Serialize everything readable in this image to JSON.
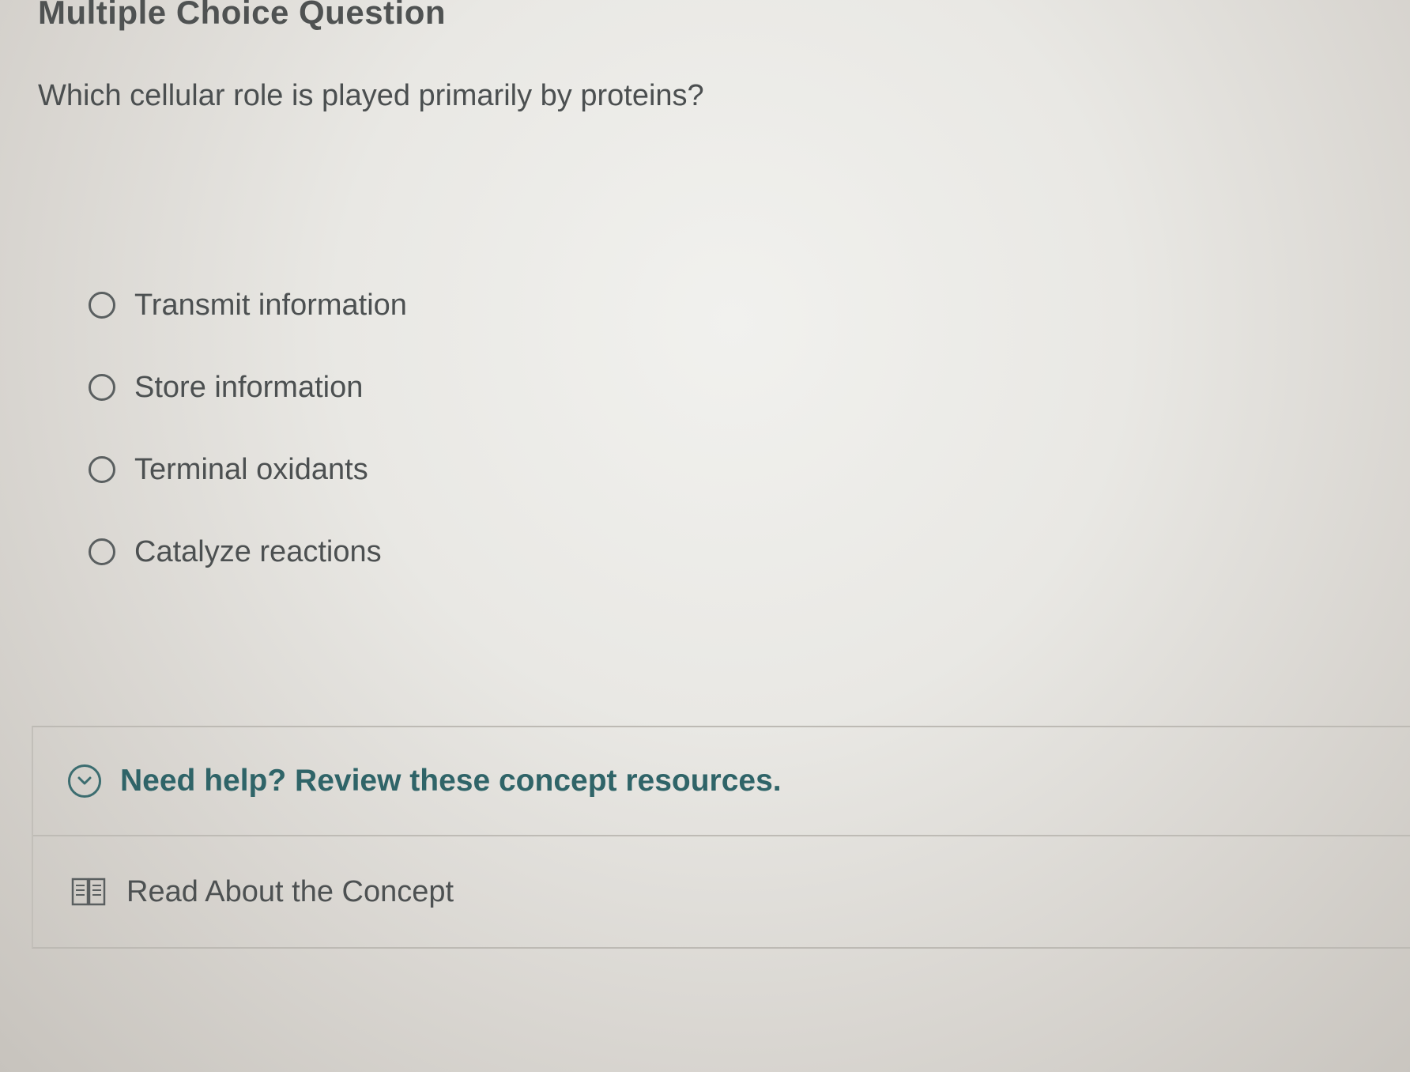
{
  "header": {
    "title": "Multiple Choice Question"
  },
  "question": {
    "text": "Which cellular role is played primarily by proteins?"
  },
  "options": [
    {
      "label": "Transmit information",
      "selected": false
    },
    {
      "label": "Store information",
      "selected": false
    },
    {
      "label": "Terminal oxidants",
      "selected": false
    },
    {
      "label": "Catalyze reactions",
      "selected": false
    }
  ],
  "resources": {
    "help_label": "Need help? Review these concept resources.",
    "help_icon": "chevron-down-circle-icon",
    "read_label": "Read About the Concept",
    "read_icon": "book-icon"
  },
  "colors": {
    "accent": "#2f6468",
    "text": "#4b4f50"
  }
}
